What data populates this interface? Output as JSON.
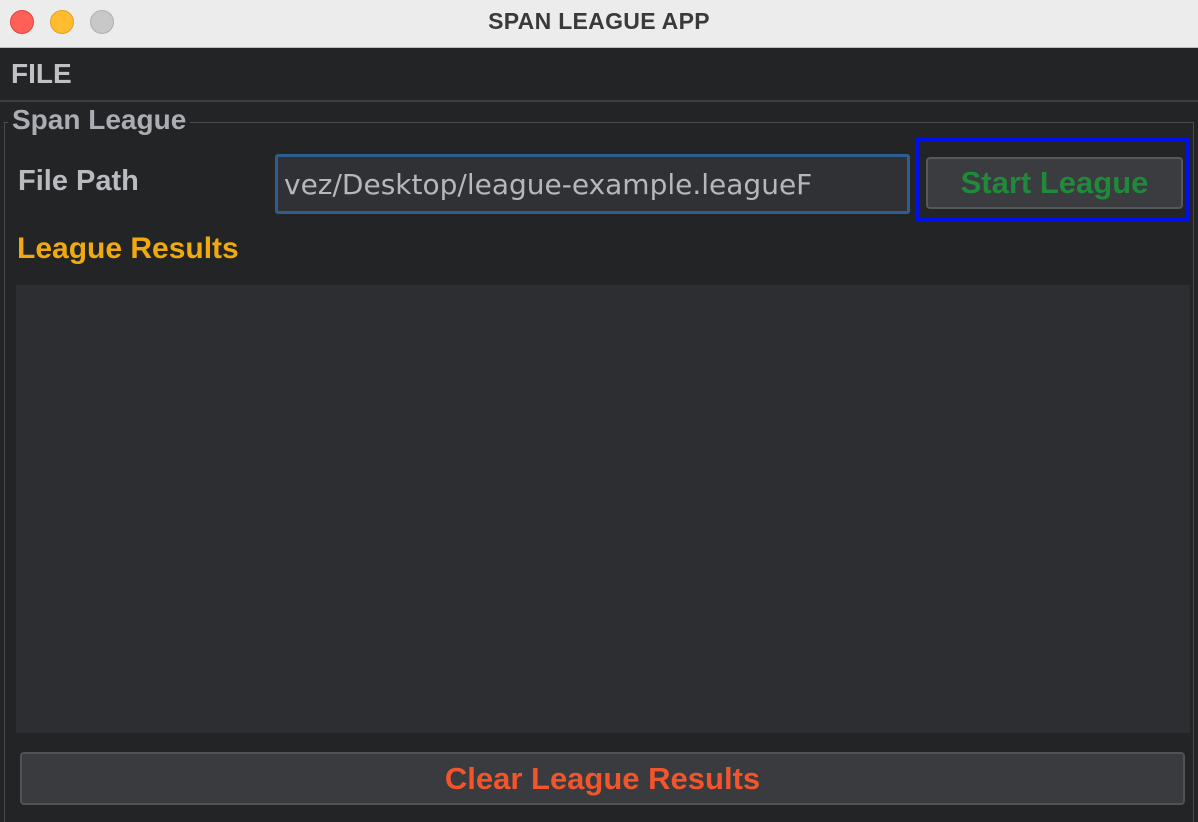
{
  "window": {
    "title": "SPAN LEAGUE APP"
  },
  "menu": {
    "items": [
      {
        "label": "FILE"
      }
    ]
  },
  "group": {
    "title": "Span League"
  },
  "form": {
    "file_path_label": "File Path",
    "file_path_value": "vez/Desktop/league-example.leagueF",
    "start_button_label": "Start League"
  },
  "results": {
    "label": "League Results",
    "content": "",
    "clear_button_label": "Clear League Results"
  },
  "colors": {
    "start_button_text": "#1e8a3a",
    "results_label": "#f0aa0e",
    "clear_button_text": "#f2552c",
    "highlight_border": "#0011ee",
    "input_focus_border": "#2e5d8f"
  }
}
